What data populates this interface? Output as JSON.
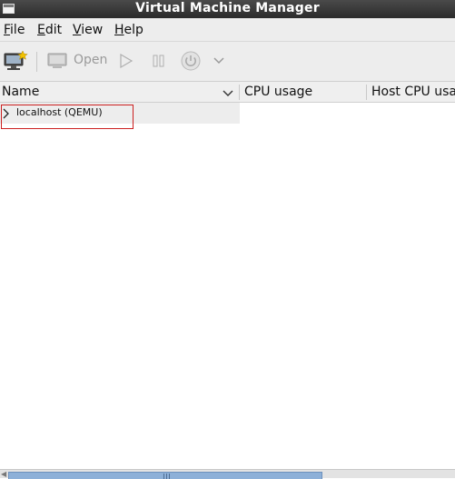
{
  "window": {
    "title": "Virtual Machine Manager"
  },
  "menubar": [
    {
      "mnemonic": "F",
      "rest": "ile"
    },
    {
      "mnemonic": "E",
      "rest": "dit"
    },
    {
      "mnemonic": "V",
      "rest": "iew"
    },
    {
      "mnemonic": "H",
      "rest": "elp"
    }
  ],
  "toolbar": {
    "open_label": "Open"
  },
  "table": {
    "columns": [
      "Name",
      "CPU usage",
      "Host CPU usage"
    ],
    "rows": [
      {
        "name": "localhost (QEMU)"
      }
    ]
  }
}
